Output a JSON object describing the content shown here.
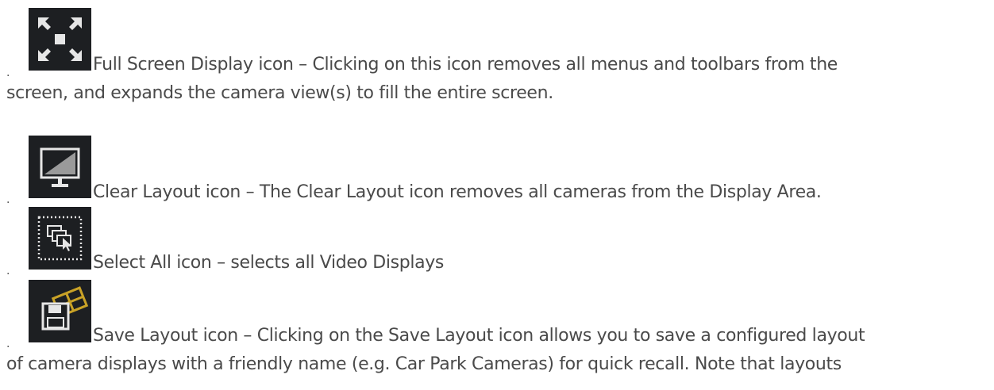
{
  "items": [
    {
      "icon": "fullscreen-icon",
      "bullet": "·",
      "line1": "Full Screen Display icon – Clicking on this icon removes all menus and toolbars from the",
      "line2": "screen, and expands the camera view(s) to fill the entire screen."
    },
    {
      "icon": "monitor-icon",
      "bullet": "·",
      "line1": "Clear Layout icon – The Clear Layout icon removes all cameras from the Display Area."
    },
    {
      "icon": "select-all-icon",
      "bullet": "·",
      "line1": "Select All icon – selects all Video Displays"
    },
    {
      "icon": "save-layout-icon",
      "bullet": "·",
      "line1": "Save Layout icon – Clicking on the Save Layout icon allows you to save a configured layout",
      "line2": "of camera displays with a friendly name (e.g. Car Park Cameras) for quick recall. Note that layouts"
    }
  ],
  "colors": {
    "text": "#4a4a4a",
    "icon_background": "#1d1f22",
    "icon_glyph": "#e0e0e0",
    "save_accent": "#c9a227"
  }
}
